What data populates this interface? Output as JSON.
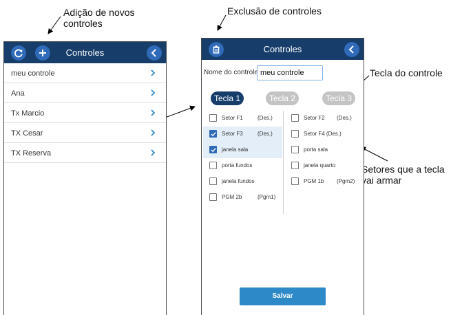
{
  "annotations": {
    "add": "Adição de novos\ncontroles",
    "delete": "Exclusão de controles",
    "key": "Tecla do controle",
    "sectors": "Setores que a tecla\nvai armar"
  },
  "list_screen": {
    "title": "Controles",
    "items": [
      {
        "label": "meu controle"
      },
      {
        "label": "Ana"
      },
      {
        "label": "Tx Marcio"
      },
      {
        "label": "TX Cesar"
      },
      {
        "label": "TX Reserva"
      }
    ]
  },
  "edit_screen": {
    "title": "Controles",
    "name_label": "Nome do controle",
    "name_value": "meu controle",
    "tabs": [
      {
        "label": "Tecla 1",
        "active": true
      },
      {
        "label": "Tecla 2",
        "active": false
      },
      {
        "label": "Tecla 3",
        "active": false
      }
    ],
    "sectors_left": [
      {
        "name": "Setor F1",
        "status": "(Des.)",
        "checked": false
      },
      {
        "name": "Setor F3",
        "status": "(Des.)",
        "checked": true
      },
      {
        "name": "janela sala",
        "status": "",
        "checked": true
      },
      {
        "name": "porta fundos",
        "status": "",
        "checked": false
      },
      {
        "name": "janela fundos",
        "status": "",
        "checked": false
      },
      {
        "name": "PGM 2b",
        "status": "(Pgm1)",
        "checked": false
      }
    ],
    "sectors_right": [
      {
        "name": "Setor F2",
        "status": "(Des.)",
        "checked": false
      },
      {
        "name": "Setor F4 (Des.)",
        "status": "",
        "checked": false
      },
      {
        "name": "porta sala",
        "status": "",
        "checked": false
      },
      {
        "name": "janela quarto",
        "status": "",
        "checked": false
      },
      {
        "name": "PGM 1b",
        "status": "(Pgm2)",
        "checked": false
      }
    ],
    "save_label": "Salvar"
  },
  "colors": {
    "appbar": "#173d6b",
    "icon_button": "#2f6bb8",
    "save_button": "#2e89c9",
    "tab_inactive": "#c4c4c4"
  }
}
